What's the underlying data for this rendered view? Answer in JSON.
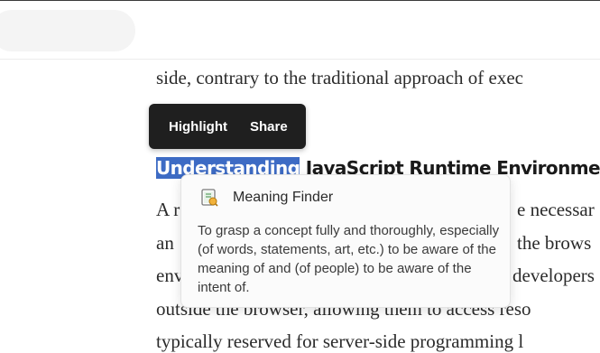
{
  "article": {
    "line1": "side, contrary to the traditional approach of exec",
    "heading_selected": "Understanding",
    "heading_rest": " JavaScript Runtime Environmen",
    "line3_left": "A r",
    "line3_right": "e necessar",
    "line4_left": "an",
    "line4_right": "the brows",
    "line5_left": "env",
    "line5_right": "developers",
    "line6": "outside the browser, allowing them to access reso",
    "line7": "typically reserved for server-side programming l"
  },
  "selection_toolbar": {
    "highlight_label": "Highlight",
    "share_label": "Share"
  },
  "meaning_popup": {
    "title": "Meaning Finder",
    "definition": "To grasp a concept fully and thoroughly, especially (of words, statements, art, etc.) to be aware of the meaning of and (of people) to be aware of the intent of.",
    "icon": "book-icon"
  }
}
